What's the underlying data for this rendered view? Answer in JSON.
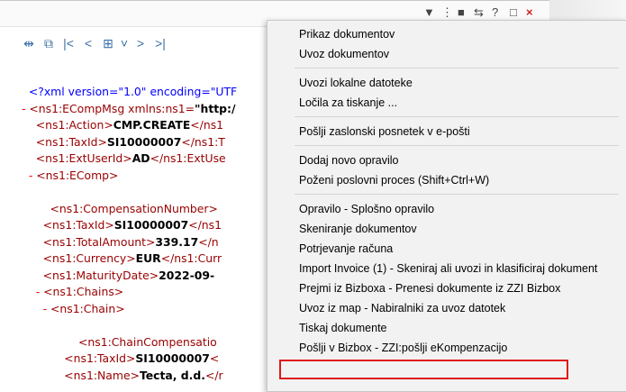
{
  "viewer": {
    "title_controls": [
      "▼",
      "⋮",
      "■",
      "⇆",
      "?",
      "□",
      "×"
    ],
    "toolbar_icons": [
      "expand-collapse-icon",
      "zoom-icon",
      "first-page-icon",
      "prev-page-icon",
      "page-view-icon",
      "dropdown-icon",
      "next-page-icon",
      "last-page-icon"
    ],
    "toolbar_glyphs": [
      "⇹",
      "⧉",
      "|<",
      "<",
      "⊞",
      "˅",
      ">",
      ">|"
    ],
    "xml_lines": [
      {
        "indent": "  ",
        "minus": "",
        "parts": [
          [
            "pi",
            "<?xml version=\"1.0\" encoding=\"UTF"
          ]
        ]
      },
      {
        "indent": "",
        "minus": "- ",
        "parts": [
          [
            "tag",
            "<ns1:ECompMsg "
          ],
          [
            "attr",
            "xmlns:ns1"
          ],
          [
            "tag",
            "="
          ],
          [
            "val",
            "\"http:/"
          ]
        ]
      },
      {
        "indent": "    ",
        "minus": "",
        "parts": [
          [
            "tag",
            "<ns1:Action>"
          ],
          [
            "val",
            "CMP.CREATE"
          ],
          [
            "tag",
            "</ns1"
          ]
        ]
      },
      {
        "indent": "    ",
        "minus": "",
        "parts": [
          [
            "tag",
            "<ns1:TaxId>"
          ],
          [
            "val",
            "SI10000007"
          ],
          [
            "tag",
            "</ns1:T"
          ]
        ]
      },
      {
        "indent": "    ",
        "minus": "",
        "parts": [
          [
            "tag",
            "<ns1:ExtUserId>"
          ],
          [
            "val",
            "AD"
          ],
          [
            "tag",
            "</ns1:ExtUse"
          ]
        ]
      },
      {
        "indent": "  ",
        "minus": "- ",
        "parts": [
          [
            "tag",
            "<ns1:EComp>"
          ]
        ]
      },
      {
        "indent": "",
        "minus": "",
        "parts": []
      },
      {
        "indent": "        ",
        "minus": "",
        "parts": [
          [
            "tag",
            "<ns1:CompensationNumber>"
          ]
        ]
      },
      {
        "indent": "      ",
        "minus": "",
        "parts": [
          [
            "tag",
            "<ns1:TaxId>"
          ],
          [
            "val",
            "SI10000007"
          ],
          [
            "tag",
            "</ns1"
          ]
        ]
      },
      {
        "indent": "      ",
        "minus": "",
        "parts": [
          [
            "tag",
            "<ns1:TotalAmount>"
          ],
          [
            "val",
            "339.17"
          ],
          [
            "tag",
            "</n"
          ]
        ]
      },
      {
        "indent": "      ",
        "minus": "",
        "parts": [
          [
            "tag",
            "<ns1:Currency>"
          ],
          [
            "val",
            "EUR"
          ],
          [
            "tag",
            "</ns1:Curr"
          ]
        ]
      },
      {
        "indent": "      ",
        "minus": "",
        "parts": [
          [
            "tag",
            "<ns1:MaturityDate>"
          ],
          [
            "val",
            "2022-09-"
          ]
        ]
      },
      {
        "indent": "    ",
        "minus": "- ",
        "parts": [
          [
            "tag",
            "<ns1:Chains>"
          ]
        ]
      },
      {
        "indent": "      ",
        "minus": "- ",
        "parts": [
          [
            "tag",
            "<ns1:Chain>"
          ]
        ]
      },
      {
        "indent": "",
        "minus": "",
        "parts": []
      },
      {
        "indent": "                ",
        "minus": "",
        "parts": [
          [
            "tag",
            "<ns1:ChainCompensatio"
          ]
        ]
      },
      {
        "indent": "            ",
        "minus": "",
        "parts": [
          [
            "tag",
            "<ns1:TaxId>"
          ],
          [
            "val",
            "SI10000007"
          ],
          [
            "tag",
            "<"
          ]
        ]
      },
      {
        "indent": "            ",
        "minus": "",
        "parts": [
          [
            "tag",
            "<ns1:Name>"
          ],
          [
            "val",
            "Tecta, d.d."
          ],
          [
            "tag",
            "</r"
          ]
        ]
      }
    ]
  },
  "context_menu": {
    "items": [
      {
        "label": "Prikaz dokumentov",
        "sep_after": false
      },
      {
        "label": "Uvoz dokumentov",
        "sep_after": true
      },
      {
        "label": "Uvozi lokalne datoteke",
        "sep_after": false
      },
      {
        "label": "Ločila za tiskanje ...",
        "sep_after": true
      },
      {
        "label": "Pošlji zaslonski posnetek v e-pošti",
        "sep_after": true
      },
      {
        "label": "Dodaj novo opravilo",
        "sep_after": false
      },
      {
        "label": "Poženi poslovni proces (Shift+Ctrl+W)",
        "sep_after": true
      },
      {
        "label": "Opravilo - Splošno opravilo",
        "sep_after": false
      },
      {
        "label": "Skeniranje dokumentov",
        "sep_after": false
      },
      {
        "label": "Potrjevanje računa",
        "sep_after": false
      },
      {
        "label": "Import Invoice (1) - Skeniraj ali uvozi in klasificiraj dokument",
        "sep_after": false
      },
      {
        "label": "Prejmi iz Bizboxa - Prenesi dokumente iz ZZI Bizbox",
        "sep_after": false
      },
      {
        "label": "Uvoz iz map - Nabiralniki za uvoz datotek",
        "sep_after": false
      },
      {
        "label": "Tiskaj dokumente",
        "sep_after": false
      },
      {
        "label": "Pošlji v Bizbox - ZZI:pošlji eKompenzacijo",
        "sep_after": false,
        "highlighted": true
      }
    ],
    "highlight_color": "#e01818"
  }
}
